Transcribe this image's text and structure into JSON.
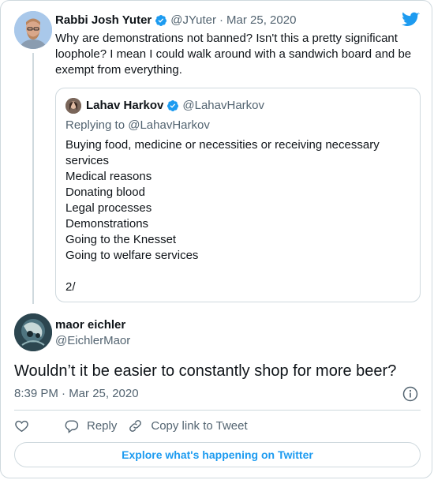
{
  "parent_tweet": {
    "author_name": "Rabbi Josh Yuter",
    "author_handle": "@JYuter",
    "separator": "·",
    "date": "Mar 25, 2020",
    "text": "Why are demonstrations not banned? Isn't this a pretty significant loophole? I mean I could walk around with a sandwich board and be exempt from everything."
  },
  "quoted_tweet": {
    "author_name": "Lahav Harkov",
    "author_handle": "@LahavHarkov",
    "replying_prefix": "Replying to",
    "replying_handle": "@LahavHarkov",
    "lines": [
      "Buying food, medicine or necessities or receiving necessary",
      "services",
      "Medical reasons",
      "Donating blood",
      "Legal processes",
      "Demonstrations",
      "Going to the Knesset",
      "Going to welfare services",
      "",
      "2/"
    ]
  },
  "main_tweet": {
    "author_name": "maor eichler",
    "author_handle": "@EichlerMaor",
    "text": "Wouldn’t it be easier to constantly shop for more beer?",
    "timestamp": "8:39 PM · Mar 25, 2020"
  },
  "actions": {
    "like_icon": "heart-icon",
    "reply_label": "Reply",
    "copy_link_label": "Copy link to Tweet"
  },
  "explore_button": "Explore what's happening on Twitter",
  "colors": {
    "twitter_blue": "#1d9bf0",
    "text": "#0f1419",
    "muted": "#536471",
    "border": "#cfd9de"
  }
}
